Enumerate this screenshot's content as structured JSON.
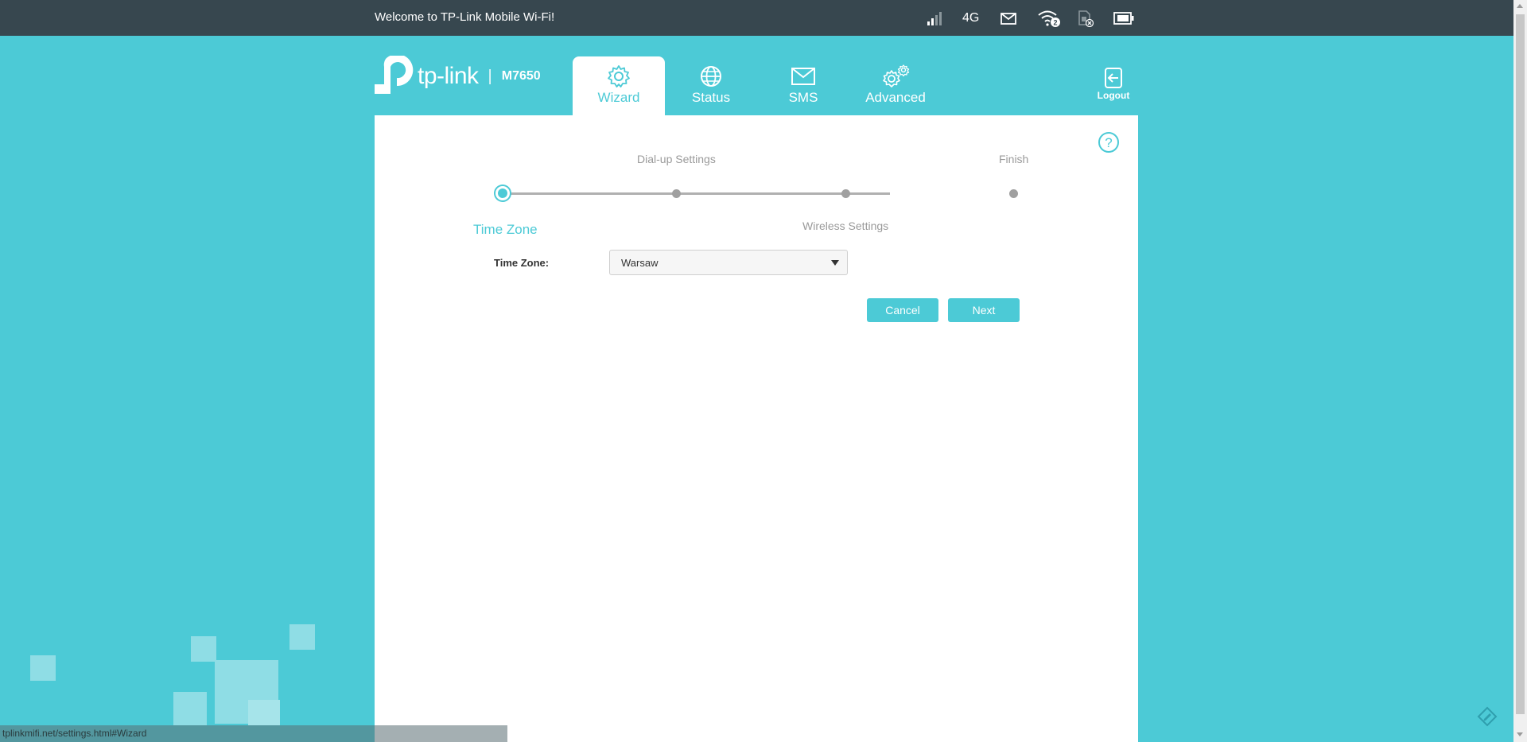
{
  "topbar": {
    "welcome": "Welcome to TP-Link Mobile Wi-Fi!",
    "network_type": "4G",
    "wifi_clients": "2",
    "icons": [
      "signal-icon",
      "message-icon",
      "wifi-icon",
      "sim-icon",
      "battery-icon"
    ]
  },
  "header": {
    "brand": "tp-link",
    "model": "M7650",
    "tabs": [
      {
        "label": "Wizard",
        "icon": "gear-icon",
        "active": true
      },
      {
        "label": "Status",
        "icon": "globe-icon",
        "active": false
      },
      {
        "label": "SMS",
        "icon": "envelope-icon",
        "active": false
      },
      {
        "label": "Advanced",
        "icon": "gears-icon",
        "active": false
      }
    ],
    "logout_label": "Logout"
  },
  "wizard": {
    "steps": [
      {
        "label": "Time Zone",
        "state": "current"
      },
      {
        "label": "Dial-up Settings",
        "state": "pending"
      },
      {
        "label": "Wireless Settings",
        "state": "pending"
      },
      {
        "label": "Finish",
        "state": "pending"
      }
    ],
    "time_zone_label": "Time Zone:",
    "time_zone_value": "Warsaw",
    "cancel_label": "Cancel",
    "next_label": "Next"
  },
  "status_bar": {
    "url": "tplinkmifi.net/settings.html#Wizard"
  },
  "colors": {
    "accent": "#4ccad6",
    "topbar": "#37474f",
    "panel": "#ffffff"
  }
}
